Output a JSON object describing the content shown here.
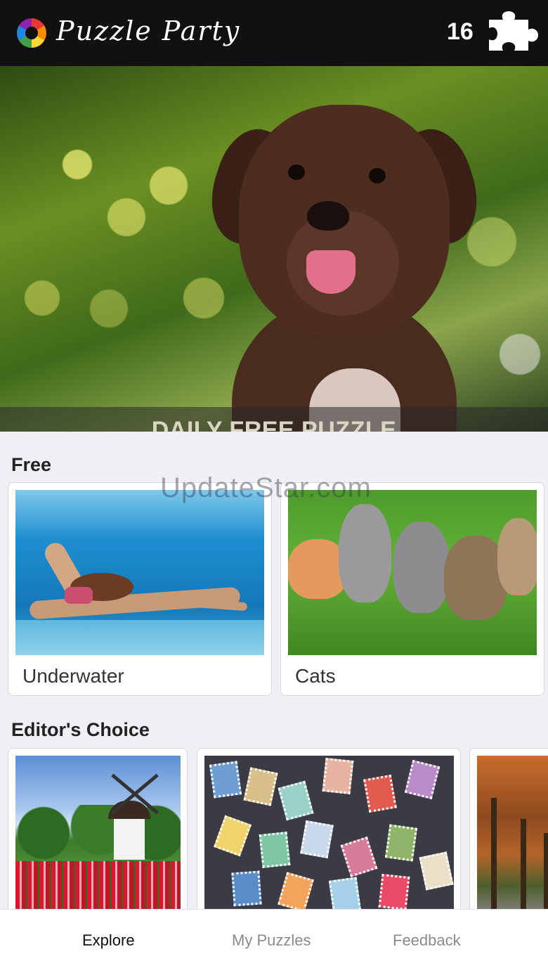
{
  "header": {
    "app_title": "Puzzle Party",
    "coin_count": "16",
    "logo_icon": "color-wheel-logo-icon",
    "puzzle_icon": "puzzle-piece-icon"
  },
  "hero": {
    "banner_text": "DAILY FREE PUZZLE"
  },
  "sections": {
    "free": {
      "title": "Free",
      "cards": [
        {
          "label": "Underwater"
        },
        {
          "label": "Cats"
        }
      ]
    },
    "editors_choice": {
      "title": "Editor's Choice"
    }
  },
  "watermark": "UpdateStar.com",
  "tabbar": {
    "tabs": [
      {
        "label": "Explore",
        "active": true
      },
      {
        "label": "My Puzzles",
        "active": false
      },
      {
        "label": "Feedback",
        "active": false
      }
    ]
  },
  "colors": {
    "header_bg": "#111111",
    "page_bg": "#efeff4",
    "active_tab": "#111111",
    "inactive_tab": "#8a8a8e"
  }
}
